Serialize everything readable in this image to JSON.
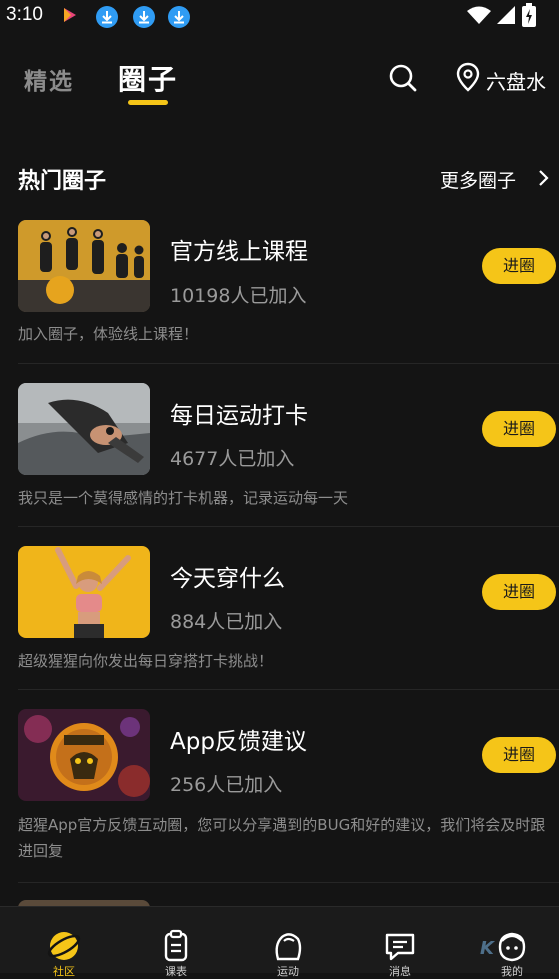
{
  "status_bar": {
    "time": "3:10"
  },
  "header": {
    "tabs": [
      {
        "label": "精选",
        "active": false
      },
      {
        "label": "圈子",
        "active": true
      }
    ],
    "location": "六盘水"
  },
  "section": {
    "title": "热门圈子",
    "more_label": "更多圈子"
  },
  "circles": [
    {
      "name": "官方线上课程",
      "members": "10198人已加入",
      "join_label": "进圈",
      "desc": "加入圈子，体验线上课程！"
    },
    {
      "name": "每日运动打卡",
      "members": "4677人已加入",
      "join_label": "进圈",
      "desc": "我只是一个莫得感情的打卡机器，记录运动每一天"
    },
    {
      "name": "今天穿什么",
      "members": "884人已加入",
      "join_label": "进圈",
      "desc": "超级猩猩向你发出每日穿搭打卡挑战！"
    },
    {
      "name": "App反馈建议",
      "members": "256人已加入",
      "join_label": "进圈",
      "desc": "超猩App官方反馈互动圈，您可以分享遇到的BUG和好的建议，我们将会及时跟进回复"
    }
  ],
  "bottom_nav": [
    {
      "label": "社区",
      "icon": "planet-icon",
      "active": true
    },
    {
      "label": "课表",
      "icon": "clipboard-icon",
      "active": false
    },
    {
      "label": "运动",
      "icon": "sport-icon",
      "active": false
    },
    {
      "label": "消息",
      "icon": "message-icon",
      "active": false
    },
    {
      "label": "我的",
      "icon": "profile-icon",
      "active": false
    }
  ],
  "watermark": "K",
  "colors": {
    "accent": "#f5c518",
    "background": "#141414",
    "download_blue": "#2f9cf4"
  }
}
